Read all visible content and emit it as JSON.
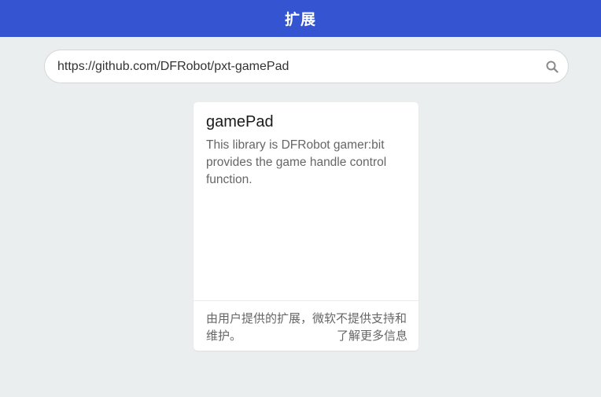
{
  "header": {
    "title": "扩展"
  },
  "search": {
    "value": "https://github.com/DFRobot/pxt-gamePad",
    "icon": "search-icon"
  },
  "card": {
    "title": "gamePad",
    "description": "This library is DFRobot gamer:bit provides the game handle control function.",
    "disclaimer": "由用户提供的扩展，微软不提供支持和维护。",
    "learn_more": "了解更多信息"
  },
  "colors": {
    "header_bg": "#3454d1",
    "page_bg": "#ebeeef"
  }
}
